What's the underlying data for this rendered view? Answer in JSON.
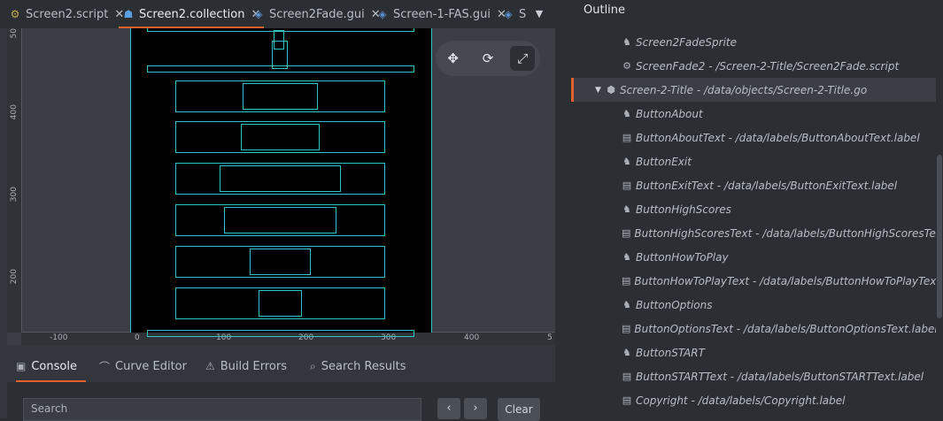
{
  "tabs": [
    {
      "label": "Screen2.script",
      "icon": "gear-icon"
    },
    {
      "label": "Screen2.collection",
      "icon": "collection-icon"
    },
    {
      "label": "Screen2Fade.gui",
      "icon": "gui-icon"
    },
    {
      "label": "Screen-1-FAS.gui",
      "icon": "gui-icon"
    },
    {
      "label": "S",
      "icon": "gui-icon"
    }
  ],
  "ruler": {
    "vertical": [
      "50",
      "400",
      "300",
      "200"
    ],
    "horizontal": [
      "-100",
      "0",
      "100",
      "200",
      "300",
      "400",
      "5"
    ]
  },
  "bottom_tabs": [
    {
      "label": "Console",
      "icon": "console-icon"
    },
    {
      "label": "Curve Editor",
      "icon": "curve-icon"
    },
    {
      "label": "Build Errors",
      "icon": "error-icon"
    },
    {
      "label": "Search Results",
      "icon": "search-icon"
    }
  ],
  "console": {
    "search_placeholder": "Search",
    "clear_label": "Clear",
    "prev": "‹",
    "next": "›"
  },
  "outline": {
    "title": "Outline",
    "items": [
      {
        "label": "Screen2FadeSprite",
        "icon": "sprite-icon",
        "indent": 2
      },
      {
        "label": "ScreenFade2 - /Screen-2-Title/Screen2Fade.script",
        "icon": "gear-icon",
        "indent": 2
      },
      {
        "label": "Screen-2-Title - /data/objects/Screen-2-Title.go",
        "icon": "gameobject-icon",
        "indent": 1,
        "expanded": true,
        "selected": true
      },
      {
        "label": "ButtonAbout",
        "icon": "sprite-icon",
        "indent": 2
      },
      {
        "label": "ButtonAboutText - /data/labels/ButtonAboutText.label",
        "icon": "label-icon",
        "indent": 2
      },
      {
        "label": "ButtonExit",
        "icon": "sprite-icon",
        "indent": 2
      },
      {
        "label": "ButtonExitText - /data/labels/ButtonExitText.label",
        "icon": "label-icon",
        "indent": 2
      },
      {
        "label": "ButtonHighScores",
        "icon": "sprite-icon",
        "indent": 2
      },
      {
        "label": "ButtonHighScoresText - /data/labels/ButtonHighScoresText.labe",
        "icon": "label-icon",
        "indent": 2
      },
      {
        "label": "ButtonHowToPlay",
        "icon": "sprite-icon",
        "indent": 2
      },
      {
        "label": "ButtonHowToPlayText - /data/labels/ButtonHowToPlayText.lab",
        "icon": "label-icon",
        "indent": 2
      },
      {
        "label": "ButtonOptions",
        "icon": "sprite-icon",
        "indent": 2
      },
      {
        "label": "ButtonOptionsText - /data/labels/ButtonOptionsText.label",
        "icon": "label-icon",
        "indent": 2
      },
      {
        "label": "ButtonSTART",
        "icon": "sprite-icon",
        "indent": 2
      },
      {
        "label": "ButtonSTARTText - /data/labels/ButtonSTARTText.label",
        "icon": "label-icon",
        "indent": 2
      },
      {
        "label": "Copyright - /data/labels/Copyright.label",
        "icon": "label-icon",
        "indent": 2
      }
    ]
  },
  "colors": {
    "accent": "#e2622f",
    "wire": "#2ec4c4"
  }
}
